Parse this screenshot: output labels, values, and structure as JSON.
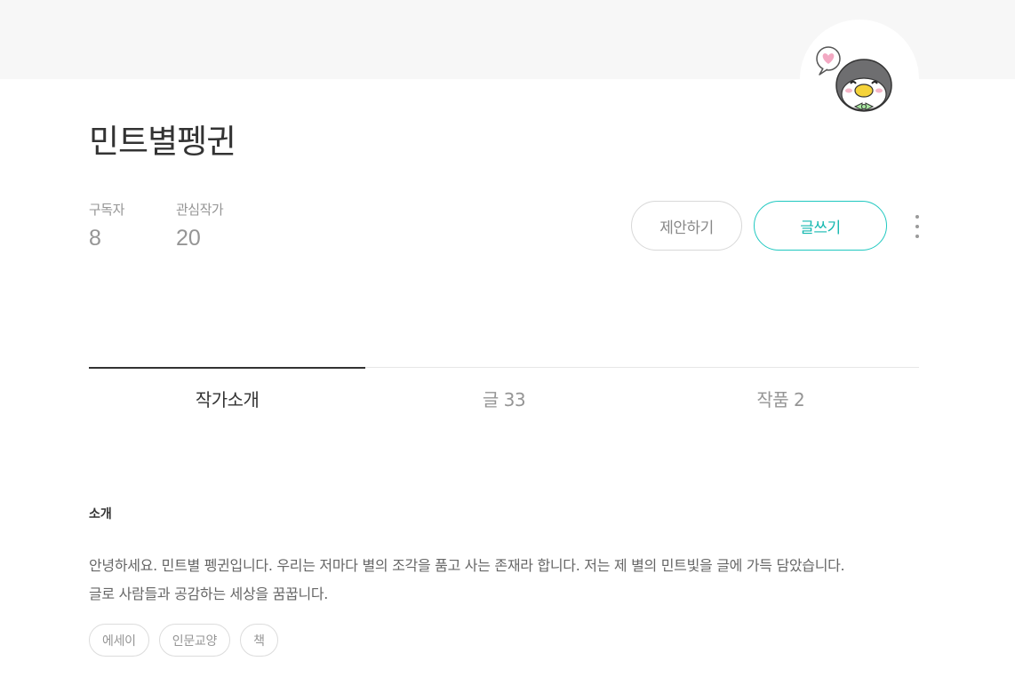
{
  "profile": {
    "name": "민트별펭귄",
    "avatar_icon": "penguin-avatar-icon",
    "stats": {
      "subscribers_label": "구독자",
      "subscribers_value": "8",
      "following_label": "관심작가",
      "following_value": "20"
    }
  },
  "actions": {
    "suggest_label": "제안하기",
    "write_label": "글쓰기",
    "more_icon": "more-vertical-icon"
  },
  "tabs": [
    {
      "label": "작가소개",
      "active": true
    },
    {
      "label": "글 33",
      "active": false
    },
    {
      "label": "작품 2",
      "active": false
    }
  ],
  "about": {
    "section_title": "소개",
    "lines": [
      "안녕하세요. 민트별 펭귄입니다. 우리는 저마다 별의 조각을 품고 사는 존재라 합니다. 저는 제 별의 민트빛을 글에 가득 담았습니다.",
      "글로 사람들과 공감하는 세상을 꿈꿉니다."
    ],
    "keywords": [
      "에세이",
      "인문교양",
      "책"
    ]
  },
  "colors": {
    "accent": "#1fc8c0",
    "text_primary": "#333333",
    "text_muted": "#959595",
    "header_band": "#f7f7f7"
  }
}
